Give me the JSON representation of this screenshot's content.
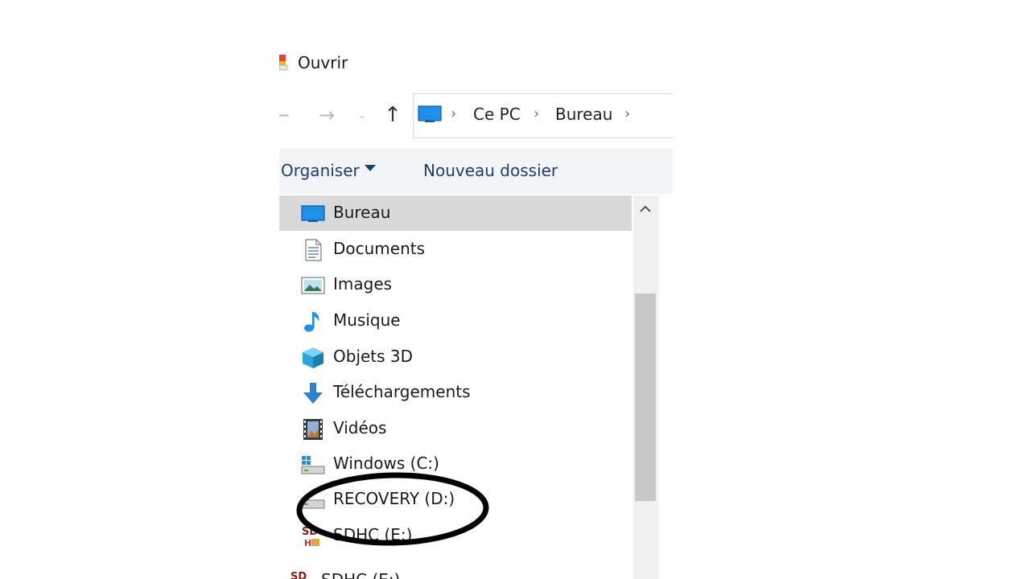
{
  "window": {
    "title": "Ouvrir"
  },
  "navigation": {
    "back_glyph": "←",
    "forward_glyph": "→",
    "recent_glyph": "⌄",
    "up_glyph": "↑",
    "breadcrumb": [
      "Ce PC",
      "Bureau"
    ],
    "separator": "›"
  },
  "toolbar": {
    "organise_label": "Organiser",
    "new_folder_label": "Nouveau dossier"
  },
  "nav_pane": {
    "items": [
      {
        "label": "Bureau",
        "icon": "desktop-icon",
        "selected": true
      },
      {
        "label": "Documents",
        "icon": "documents-icon"
      },
      {
        "label": "Images",
        "icon": "pictures-icon"
      },
      {
        "label": "Musique",
        "icon": "music-icon"
      },
      {
        "label": "Objets 3D",
        "icon": "3d-objects-icon"
      },
      {
        "label": "Téléchargements",
        "icon": "downloads-icon"
      },
      {
        "label": "Vidéos",
        "icon": "videos-icon"
      },
      {
        "label": "Windows (C:)",
        "icon": "windows-drive-icon"
      },
      {
        "label": "RECOVERY (D:)",
        "icon": "drive-icon"
      },
      {
        "label": "SDHC (E:)",
        "icon": "sd-card-icon"
      },
      {
        "label": "SDHC (E:)",
        "icon": "sd-card-icon"
      }
    ]
  },
  "colors": {
    "accent_text": "#1f3c6e",
    "selection": "#d9d9d9",
    "annotation": "#000000"
  }
}
